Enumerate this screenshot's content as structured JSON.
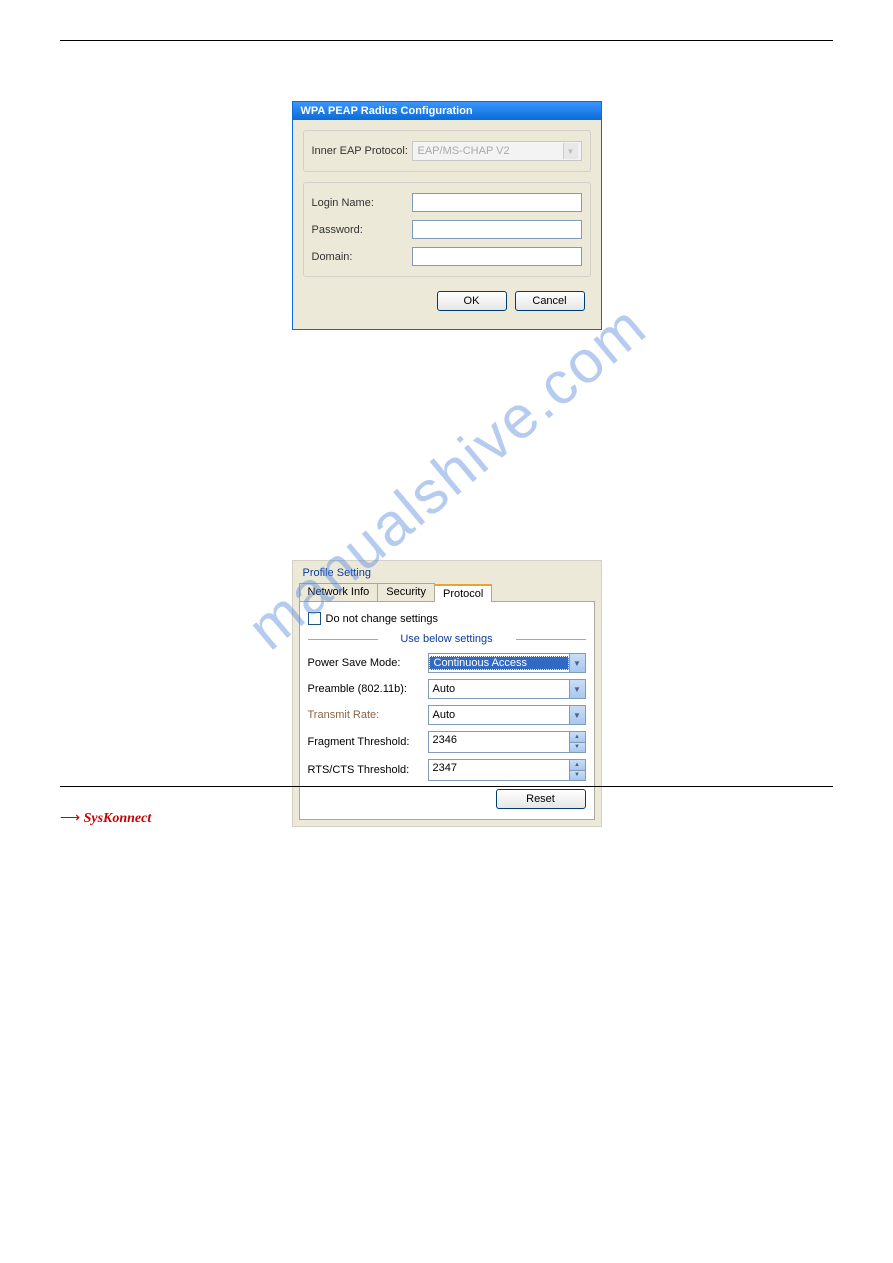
{
  "watermark": "manualshive.com",
  "dialog1": {
    "title": "WPA PEAP Radius Configuration",
    "inner_eap_label": "Inner EAP Protocol:",
    "inner_eap_value": "EAP/MS-CHAP V2",
    "login_label": "Login Name:",
    "login_value": "",
    "password_label": "Password:",
    "password_value": "",
    "domain_label": "Domain:",
    "domain_value": "",
    "ok_label": "OK",
    "cancel_label": "Cancel"
  },
  "dialog2": {
    "fieldset_title": "Profile Setting",
    "tabs": [
      "Network Info",
      "Security",
      "Protocol"
    ],
    "active_tab": "Protocol",
    "checkbox_label": "Do not change settings",
    "divider_label": "Use below settings",
    "rows": {
      "power_save": {
        "label": "Power Save Mode:",
        "value": "Continuous Access"
      },
      "preamble": {
        "label": "Preamble (802.11b):",
        "value": "Auto"
      },
      "transmit": {
        "label": "Transmit Rate:",
        "value": "Auto"
      },
      "fragment": {
        "label": "Fragment Threshold:",
        "value": "2346"
      },
      "rtscts": {
        "label": "RTS/CTS Threshold:",
        "value": "2347"
      }
    },
    "reset_label": "Reset"
  },
  "footer": {
    "logo_text": "SysKonnect"
  }
}
